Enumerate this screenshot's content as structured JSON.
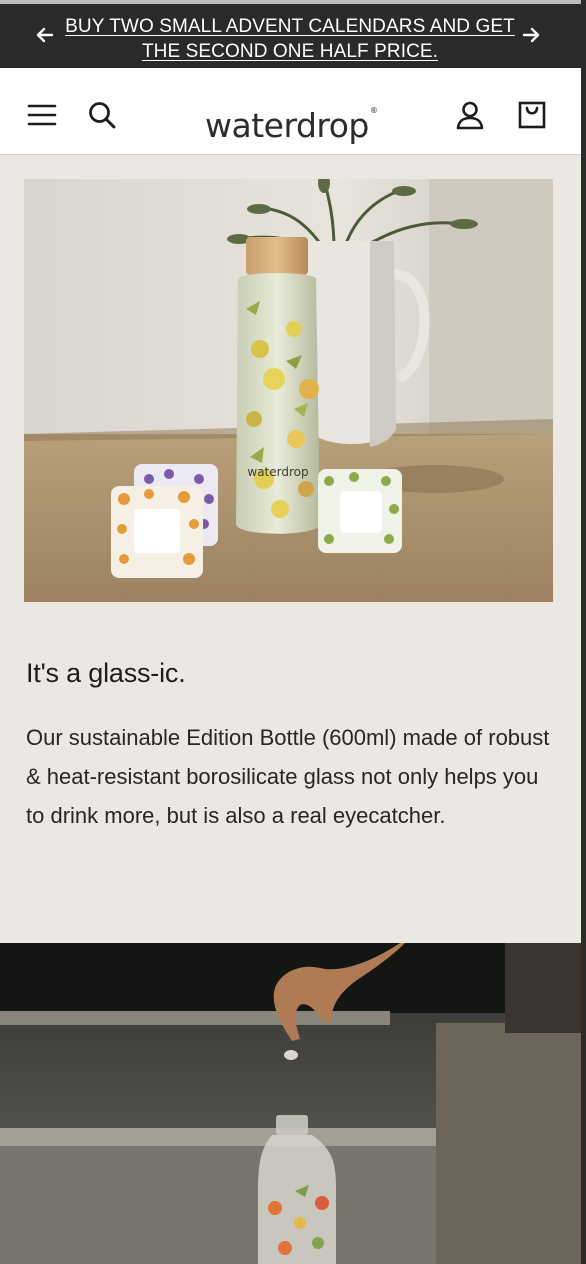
{
  "announcement": {
    "text": "BUY TWO SMALL ADVENT CALENDARS AND GET THE SECOND ONE HALF PRICE.",
    "prev_icon": "arrow-left-icon",
    "next_icon": "arrow-right-icon"
  },
  "header": {
    "logo": "waterdrop",
    "menu_icon": "hamburger-menu-icon",
    "search_icon": "search-icon",
    "account_icon": "account-icon",
    "cart_icon": "shopping-bag-icon"
  },
  "section": {
    "heading": "It's a glass-ic.",
    "description": "Our sustainable Edition Bottle (600ml) made of robust & heat-resistant borosilicate glass not only helps you to drink more, but is also a real eyecatcher."
  },
  "hero_image": {
    "bottle_brand": "waterdrop"
  },
  "colors": {
    "announcement_bg": "#2a2a2a",
    "header_bg": "#ffffff",
    "page_bg": "#ebe8e4"
  }
}
